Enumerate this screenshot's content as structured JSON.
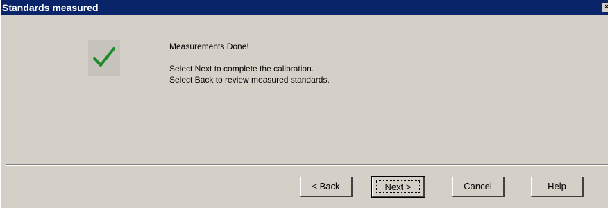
{
  "window": {
    "title": "Standards measured",
    "close_glyph": "×"
  },
  "content": {
    "icon": "checkmark-icon",
    "accent_color": "#1e8a2a",
    "message_done": "Measurements Done!",
    "message_next": "Select Next to complete the calibration.",
    "message_back": "Select Back to review measured standards."
  },
  "buttons": {
    "back_label": "< Back",
    "next_label": "Next >",
    "cancel_label": "Cancel",
    "help_label": "Help"
  }
}
